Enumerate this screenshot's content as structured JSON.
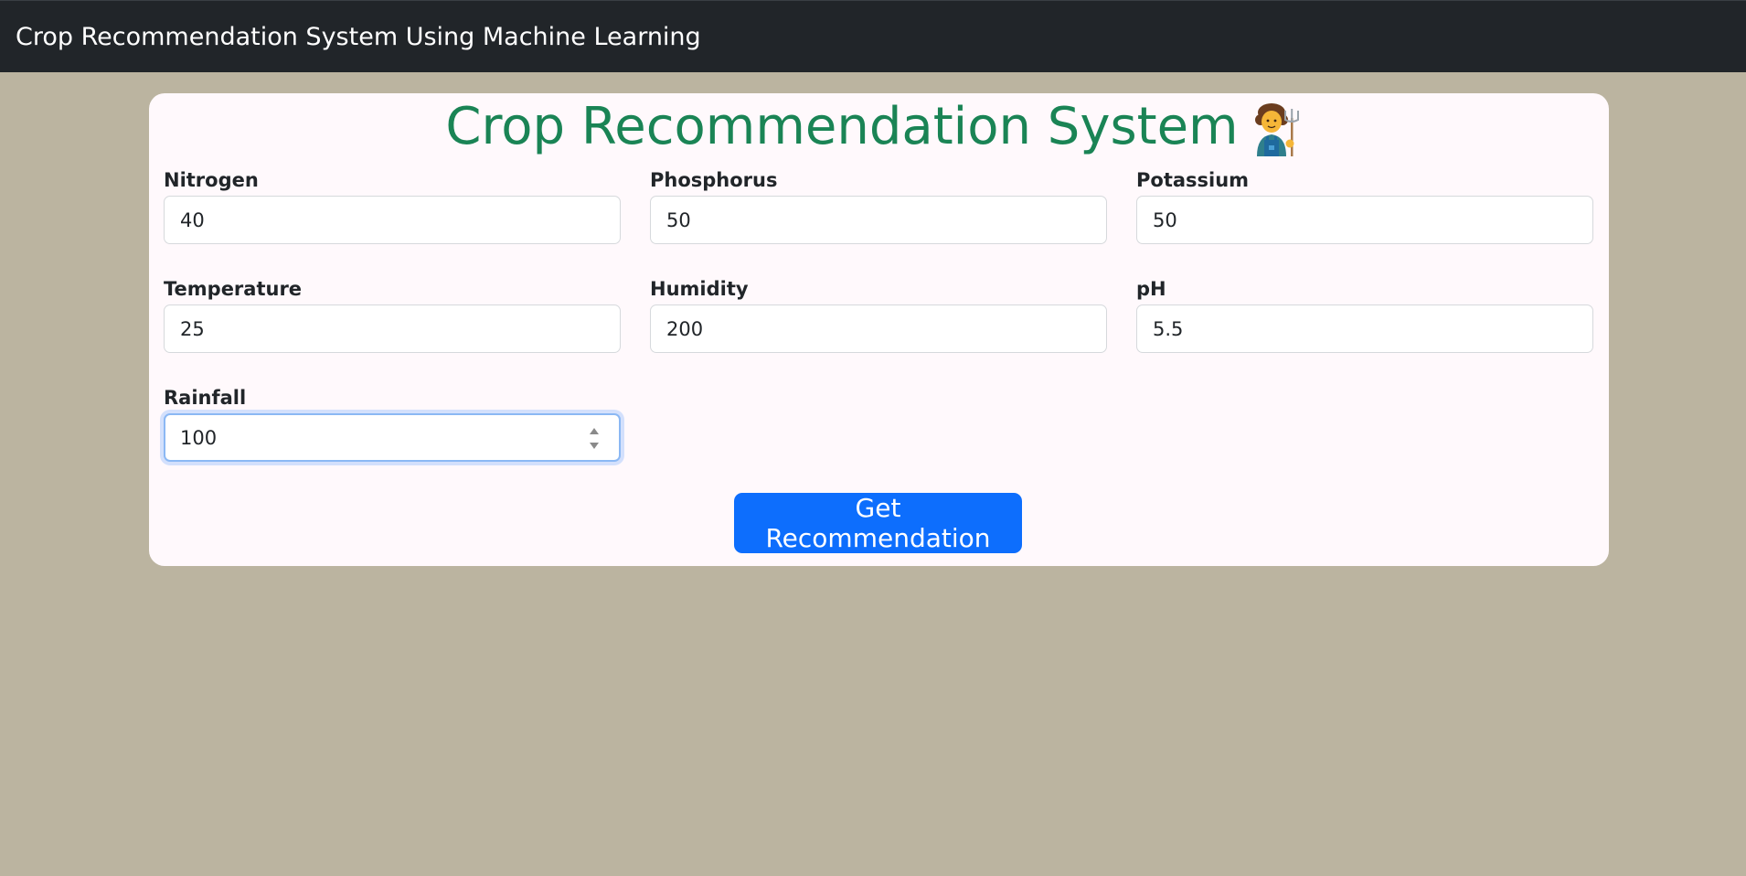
{
  "navbar": {
    "brand": "Crop Recommendation System Using Machine Learning"
  },
  "form": {
    "title": "Crop Recommendation System",
    "title_icon": "farmer-icon",
    "fields": [
      {
        "label": "Nitrogen",
        "value": "40"
      },
      {
        "label": "Phosphorus",
        "value": "50"
      },
      {
        "label": "Potassium",
        "value": "50"
      },
      {
        "label": "Temperature",
        "value": "25"
      },
      {
        "label": "Humidity",
        "value": "200"
      },
      {
        "label": "pH",
        "value": "5.5"
      },
      {
        "label": "Rainfall",
        "value": "100"
      }
    ],
    "submit_label": "Get Recommendation"
  },
  "colors": {
    "navbar_bg": "#212529",
    "page_bg": "#bbb4a0",
    "title_green": "#1a8455",
    "button_blue": "#0d6efd"
  }
}
